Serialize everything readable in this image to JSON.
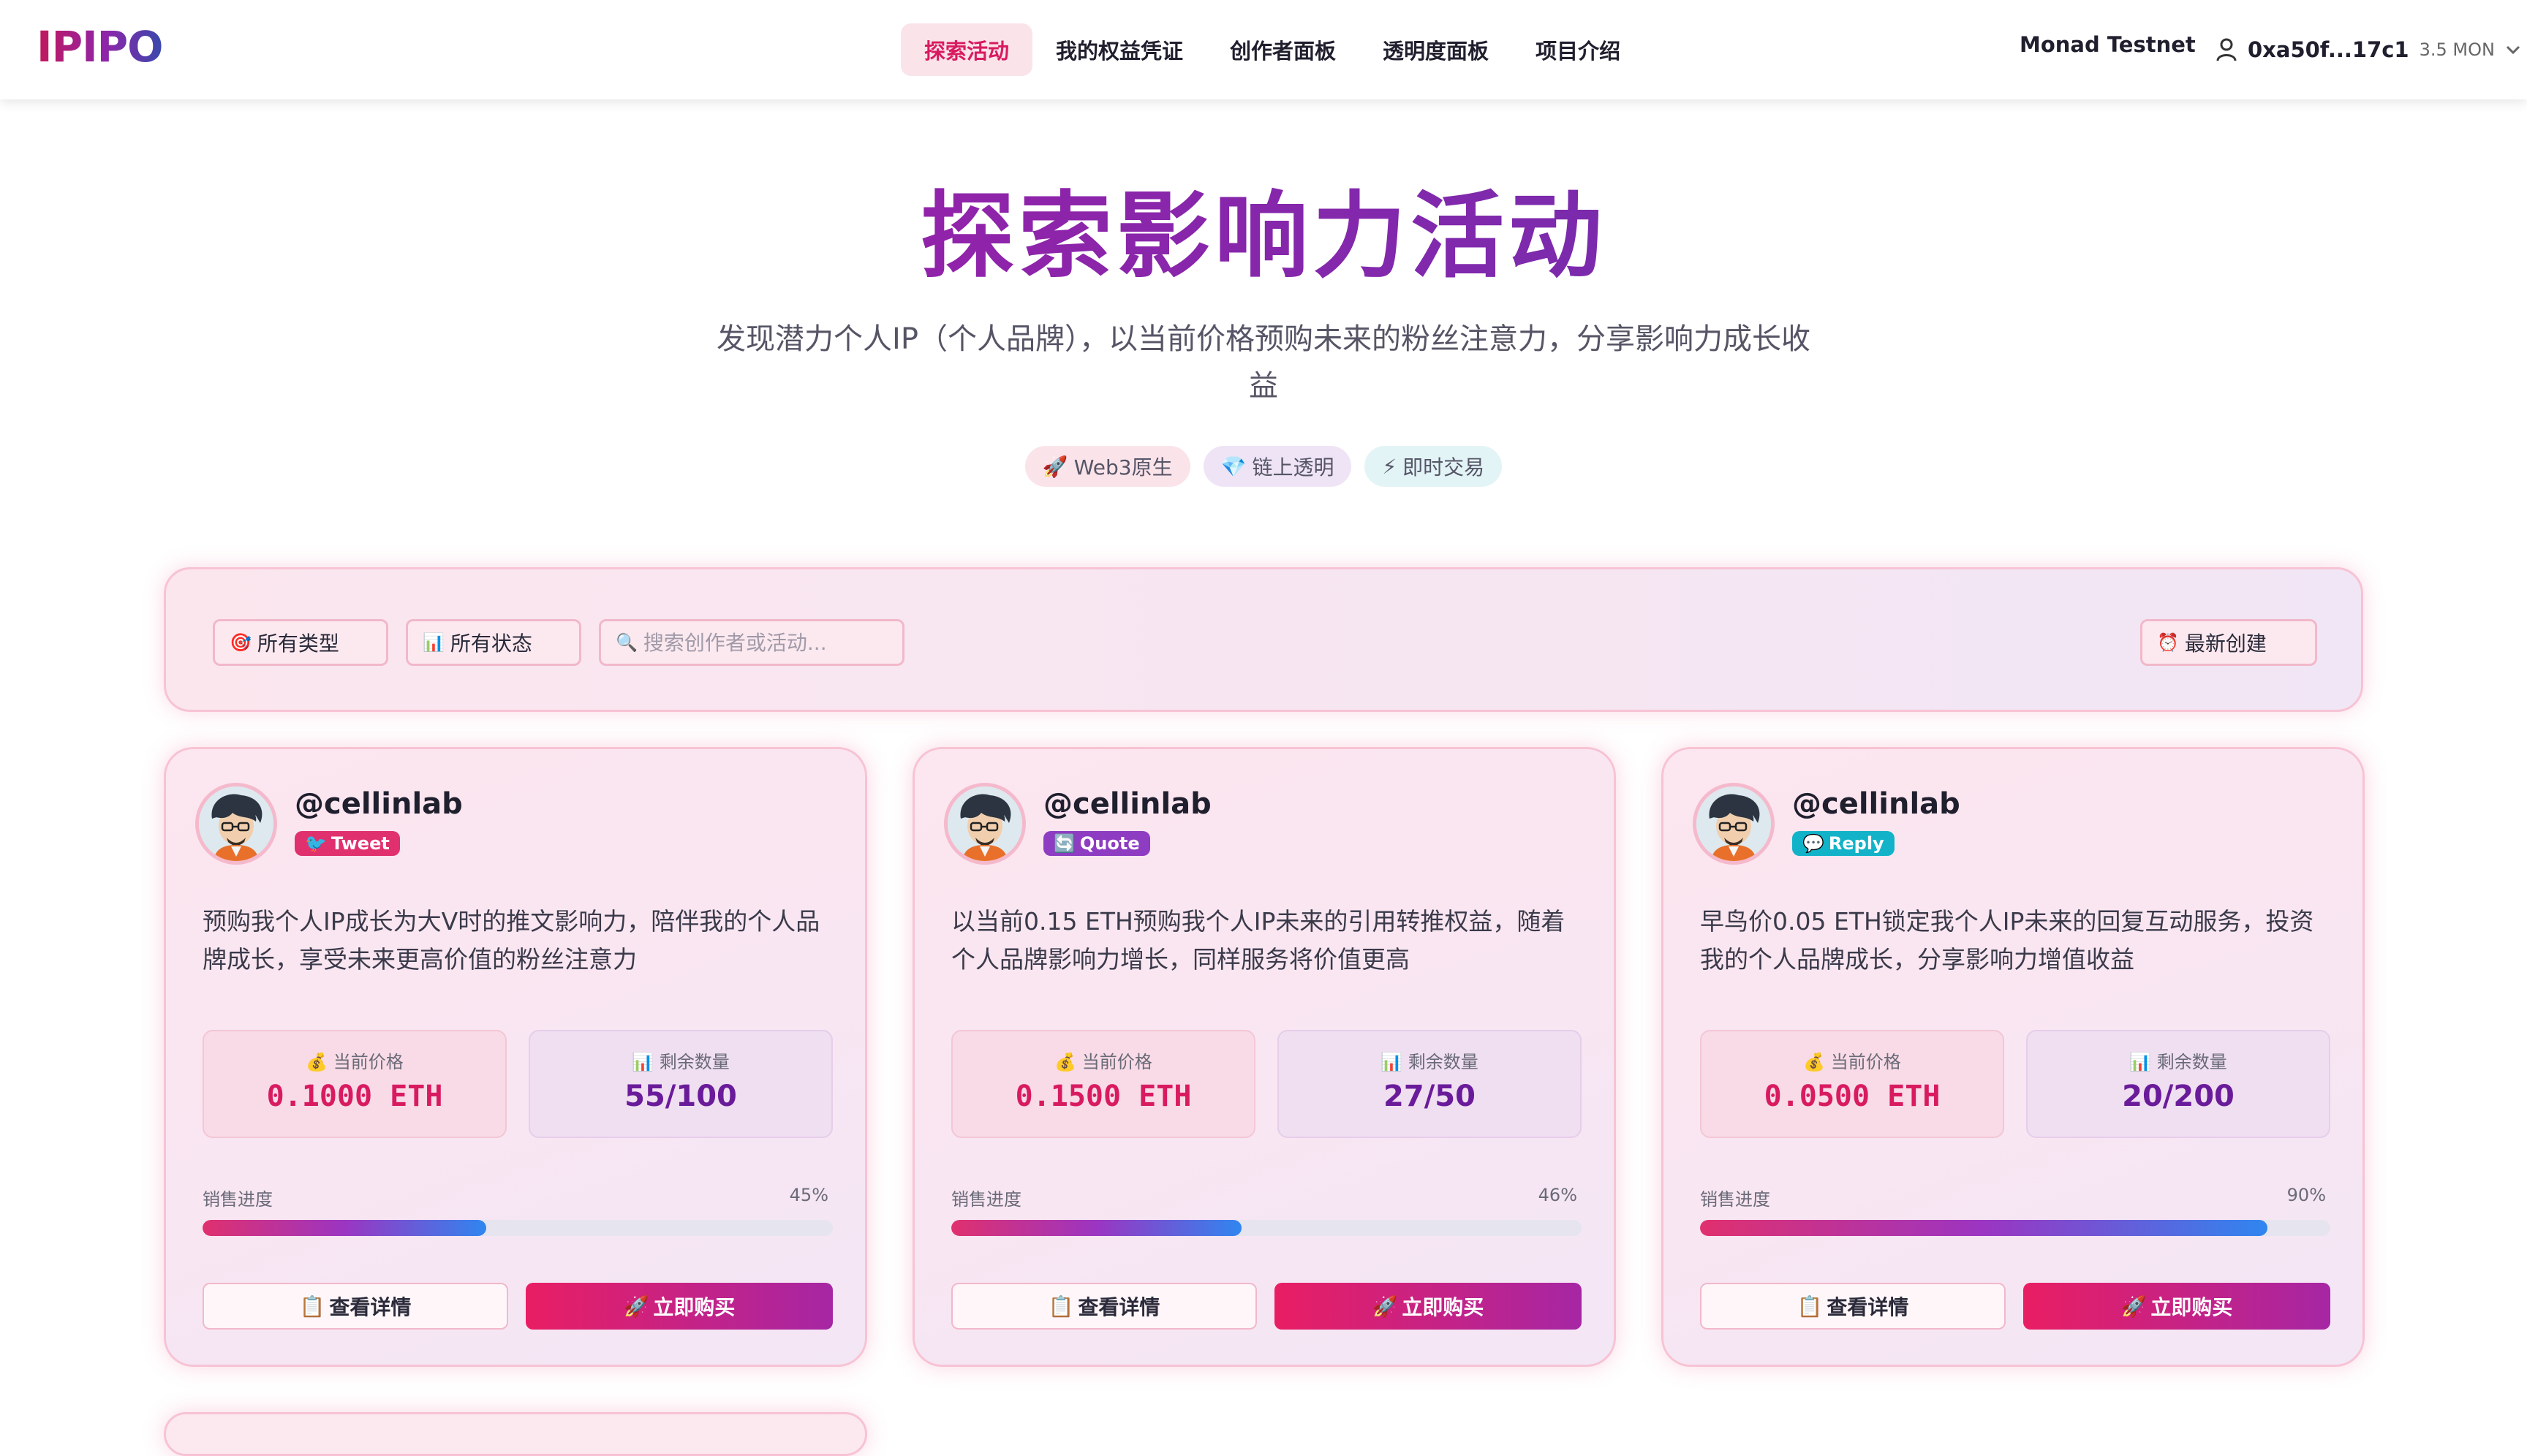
{
  "brand": {
    "logo": "IPIPO"
  },
  "nav": {
    "links": [
      "探索活动",
      "我的权益凭证",
      "创作者面板",
      "透明度面板",
      "项目介绍"
    ],
    "active_index": 0,
    "network": "Monad Testnet",
    "account_address": "0xa50f...17c1",
    "account_balance": "3.5 MON"
  },
  "hero": {
    "title": "探索影响力活动",
    "subtitle": "发现潜力个人IP（个人品牌），以当前价格预购未来的粉丝注意力，分享影响力成长收益",
    "tags": [
      {
        "icon": "🚀",
        "label": "Web3原生"
      },
      {
        "icon": "💎",
        "label": "链上透明"
      },
      {
        "icon": "⚡",
        "label": "即时交易"
      }
    ]
  },
  "filters": {
    "type_icon": "🎯",
    "type_label": "所有类型",
    "status_icon": "📊",
    "status_label": "所有状态",
    "search_icon": "🔍",
    "search_placeholder": "搜索创作者或活动...",
    "sort_icon": "⏰",
    "sort_label": "最新创建"
  },
  "card_labels": {
    "price_icon": "💰",
    "price_label": "当前价格",
    "remain_icon": "📊",
    "remain_label": "剩余数量",
    "progress_label": "销售进度",
    "detail_icon": "📋",
    "detail_label": "查看详情",
    "buy_icon": "🚀",
    "buy_label": "立即购买"
  },
  "cards": [
    {
      "handle": "@cellinlab",
      "type_icon": "🐦",
      "type": "Tweet",
      "description": "预购我个人IP成长为大V时的推文影响力，陪伴我的个人品牌成长，享受未来更高价值的粉丝注意力",
      "price": "0.1000 ETH",
      "remaining": "55/100",
      "progress_text": "45%",
      "progress": 0.45
    },
    {
      "handle": "@cellinlab",
      "type_icon": "🔄",
      "type": "Quote",
      "description": "以当前0.15 ETH预购我个人IP未来的引用转推权益，随着个人品牌影响力增长，同样服务将价值更高",
      "price": "0.1500 ETH",
      "remaining": "27/50",
      "progress_text": "46%",
      "progress": 0.46
    },
    {
      "handle": "@cellinlab",
      "type_icon": "💬",
      "type": "Reply",
      "description": "早鸟价0.05 ETH锁定我个人IP未来的回复互动服务，投资我的个人品牌成长，分享影响力增值收益",
      "price": "0.0500 ETH",
      "remaining": "20/200",
      "progress_text": "90%",
      "progress": 0.9
    }
  ],
  "colors": {
    "accent_pink": "#d81b60",
    "accent_purple": "#8e24aa",
    "accent_blue": "#2f86f0",
    "tweet_badge": "#e0306e",
    "quote_badge": "#8e3cc2",
    "reply_badge": "#12b3c8"
  }
}
